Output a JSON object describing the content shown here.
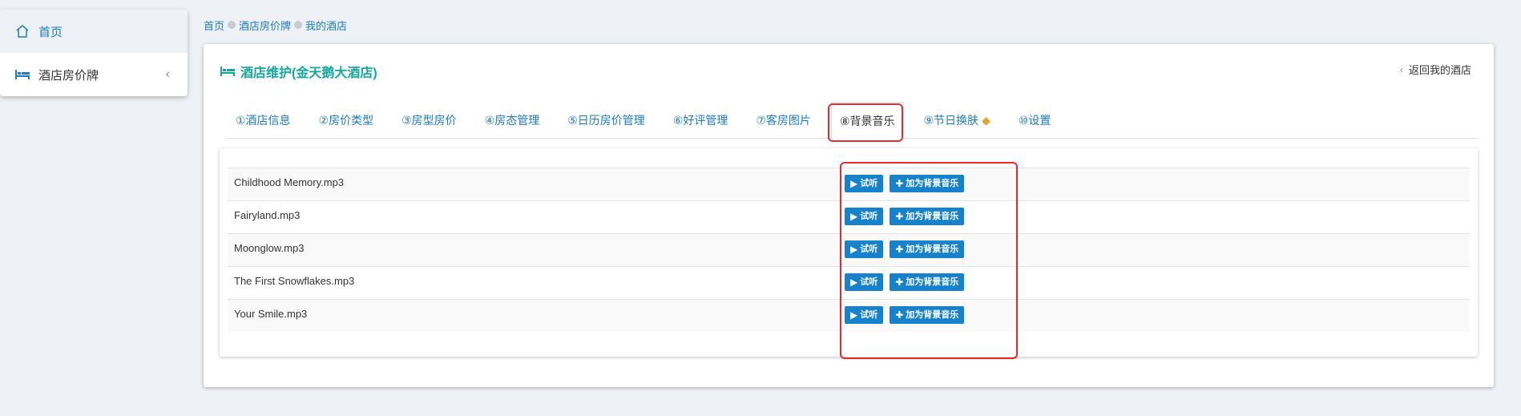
{
  "sidebar": {
    "items": [
      {
        "label": "首页",
        "icon": "home-icon",
        "active": true
      },
      {
        "label": "酒店房价牌",
        "icon": "bed-icon",
        "active": false
      }
    ]
  },
  "breadcrumb": [
    "首页",
    "酒店房价牌",
    "我的酒店"
  ],
  "panel": {
    "title": "酒店维护(金天鹅大酒店)",
    "back_label": "返回我的酒店"
  },
  "tabs": [
    {
      "label": "①酒店信息"
    },
    {
      "label": "②房价类型"
    },
    {
      "label": "③房型房价"
    },
    {
      "label": "④房态管理"
    },
    {
      "label": "⑤日历房价管理"
    },
    {
      "label": "⑥好评管理"
    },
    {
      "label": "⑦客房图片"
    },
    {
      "label": "⑧背景音乐",
      "active": true
    },
    {
      "label": "⑨节日换肤",
      "icon": "diamond-icon"
    },
    {
      "label": "⑩设置"
    }
  ],
  "music_list": [
    {
      "name": "Childhood Memory.mp3"
    },
    {
      "name": "Fairyland.mp3"
    },
    {
      "name": "Moonglow.mp3"
    },
    {
      "name": "The First Snowflakes.mp3"
    },
    {
      "name": "Your Smile.mp3"
    }
  ],
  "buttons": {
    "preview_label": "试听",
    "set_bg_label": "加为背景音乐"
  },
  "colors": {
    "accent": "#1682cc",
    "title": "#13a89e",
    "highlight": "#e52b2b"
  }
}
